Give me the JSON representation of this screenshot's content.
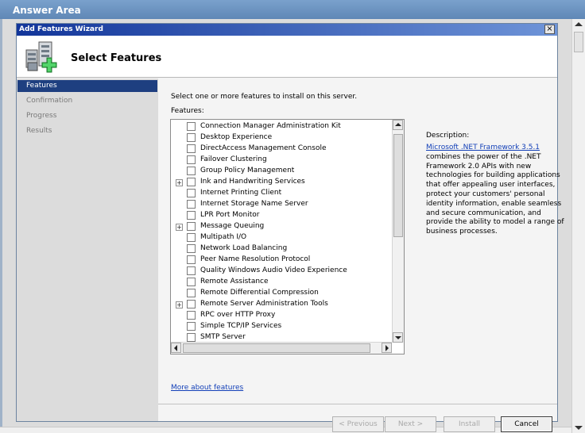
{
  "answer_area": {
    "title": "Answer Area"
  },
  "wizard": {
    "title": "Add Features Wizard",
    "close_glyph": "×",
    "page_title": "Select Features"
  },
  "nav": {
    "items": [
      {
        "label": "Features",
        "active": true
      },
      {
        "label": "Confirmation",
        "active": false
      },
      {
        "label": "Progress",
        "active": false
      },
      {
        "label": "Results",
        "active": false
      }
    ]
  },
  "content": {
    "instruction": "Select one or more features to install on this server.",
    "features_label": "Features:",
    "features": [
      {
        "label": "Connection Manager Administration Kit",
        "expandable": false,
        "checked": false
      },
      {
        "label": "Desktop Experience",
        "expandable": false,
        "checked": false
      },
      {
        "label": "DirectAccess Management Console",
        "expandable": false,
        "checked": false
      },
      {
        "label": "Failover Clustering",
        "expandable": false,
        "checked": false
      },
      {
        "label": "Group Policy Management",
        "expandable": false,
        "checked": false
      },
      {
        "label": "Ink and Handwriting Services",
        "expandable": true,
        "checked": false
      },
      {
        "label": "Internet Printing Client",
        "expandable": false,
        "checked": false
      },
      {
        "label": "Internet Storage Name Server",
        "expandable": false,
        "checked": false
      },
      {
        "label": "LPR Port Monitor",
        "expandable": false,
        "checked": false
      },
      {
        "label": "Message Queuing",
        "expandable": true,
        "checked": false
      },
      {
        "label": "Multipath I/O",
        "expandable": false,
        "checked": false
      },
      {
        "label": "Network Load Balancing",
        "expandable": false,
        "checked": false
      },
      {
        "label": "Peer Name Resolution Protocol",
        "expandable": false,
        "checked": false
      },
      {
        "label": "Quality Windows Audio Video Experience",
        "expandable": false,
        "checked": false
      },
      {
        "label": "Remote Assistance",
        "expandable": false,
        "checked": false
      },
      {
        "label": "Remote Differential Compression",
        "expandable": false,
        "checked": false
      },
      {
        "label": "Remote Server Administration Tools",
        "expandable": true,
        "checked": false
      },
      {
        "label": "RPC over HTTP Proxy",
        "expandable": false,
        "checked": false
      },
      {
        "label": "Simple TCP/IP Services",
        "expandable": false,
        "checked": false
      },
      {
        "label": "SMTP Server",
        "expandable": false,
        "checked": false
      }
    ],
    "expand_glyph": "+",
    "more_link": "More about features",
    "description_label": "Description:",
    "description_link": "Microsoft .NET Framework 3.5.1",
    "description_text": " combines the power of the .NET Framework 2.0 APIs with new technologies for building applications that offer appealing user interfaces, protect your customers' personal identity information, enable seamless and secure communication, and provide the ability to model a range of business processes."
  },
  "buttons": {
    "previous": "< Previous",
    "next": "Next >",
    "install": "Install",
    "cancel": "Cancel"
  },
  "colors": {
    "title_bar": "#12359a",
    "nav_active": "#1e3f80",
    "link": "#1340b8"
  }
}
